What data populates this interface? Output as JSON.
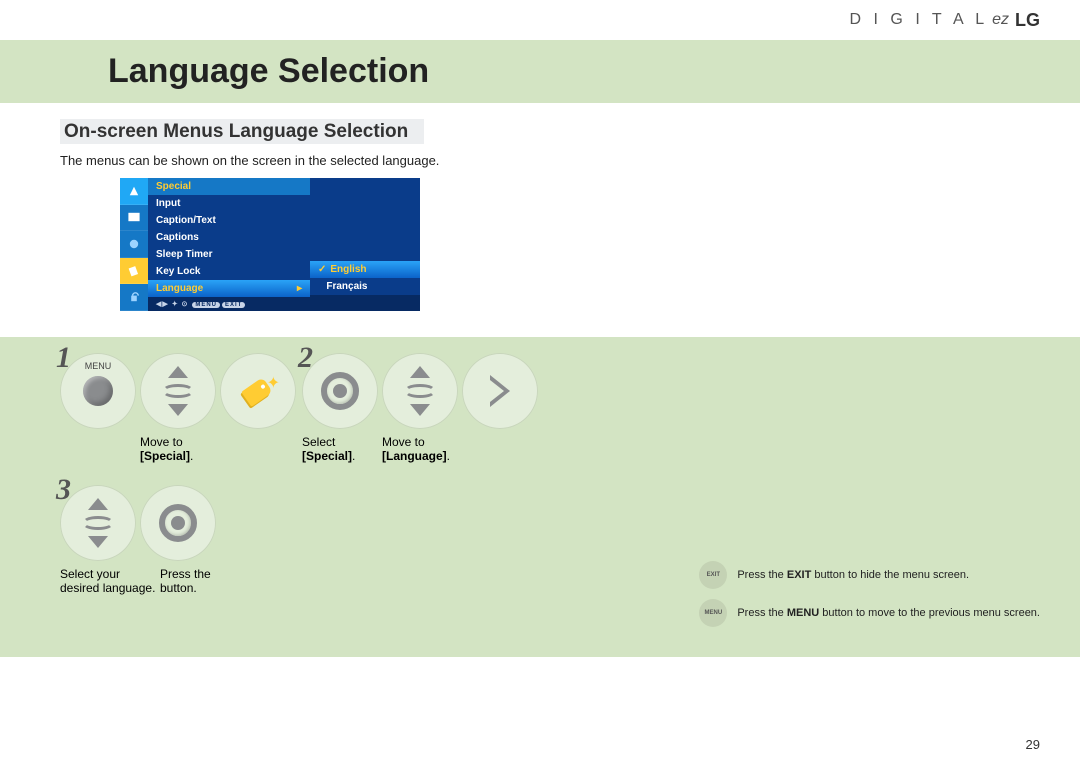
{
  "brand": {
    "pre": "D I G I T A L",
    "ez": "ez",
    "lg": "LG"
  },
  "title": "Language Selection",
  "subtitle": "On-screen Menus Language Selection",
  "intro": "The menus can be shown on the screen in the selected language.",
  "menu": {
    "header": "Special",
    "items": [
      "Input",
      "Caption/Text",
      "Captions",
      "Sleep Timer",
      "Key Lock",
      "Language"
    ],
    "options": [
      "English",
      "Français"
    ],
    "footer_menu": "MENU",
    "footer_exit": "EXIT"
  },
  "steps": {
    "s1": "1",
    "s2": "2",
    "s3": "3",
    "menu_label": "MENU",
    "cap1a": "Move to",
    "cap1b": "[Special]",
    "cap2a": "Select",
    "cap2b": "[Special]",
    "cap3a": "Move to",
    "cap3b": "[Language]",
    "cap4a": "Select your",
    "cap4b": "desired language.",
    "cap5a": "Press the",
    "cap5b": "button."
  },
  "notes": {
    "exit_label": "EXIT",
    "menu_label": "MENU",
    "exit_pre": "Press the ",
    "exit_bold": "EXIT",
    "exit_post": " button to hide the menu screen.",
    "menu_pre": "Press the ",
    "menu_bold": "MENU",
    "menu_post": " button to move to the previous menu screen."
  },
  "page": "29"
}
